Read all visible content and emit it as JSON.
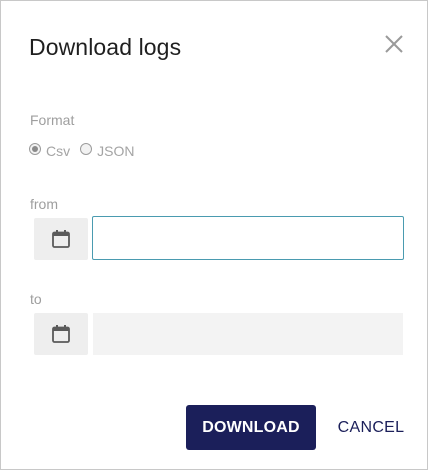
{
  "dialog": {
    "title": "Download logs",
    "close_icon": "close-icon"
  },
  "format": {
    "label": "Format",
    "options": [
      {
        "label": "Csv",
        "checked": true
      },
      {
        "label": "JSON",
        "checked": false
      }
    ]
  },
  "from": {
    "label": "from",
    "value": "",
    "icon": "calendar-icon"
  },
  "to": {
    "label": "to",
    "value": "",
    "icon": "calendar-icon",
    "disabled": true
  },
  "actions": {
    "download_label": "DOWNLOAD",
    "cancel_label": "CANCEL"
  },
  "colors": {
    "primary": "#1b1f5a",
    "focus_border": "#4a9bb0",
    "muted_text": "#9e9e9e"
  }
}
